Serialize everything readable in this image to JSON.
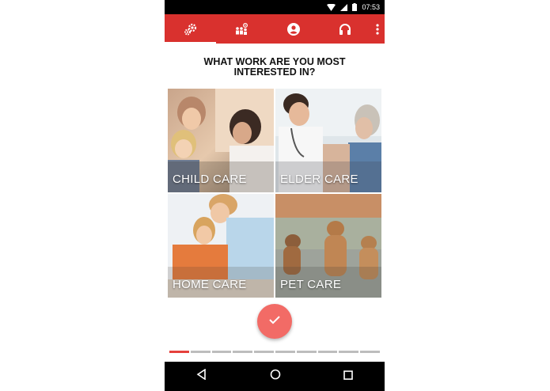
{
  "status_bar": {
    "time": "07:53",
    "icons": [
      "wifi-icon",
      "signal-icon",
      "battery-icon"
    ]
  },
  "toolbar": {
    "tabs": [
      {
        "name": "tab-settings",
        "icon": "gears-icon",
        "active": true
      },
      {
        "name": "tab-groups",
        "icon": "people-icon",
        "active": false
      },
      {
        "name": "tab-profile",
        "icon": "account-icon",
        "active": false
      },
      {
        "name": "tab-support",
        "icon": "headset-icon",
        "active": false
      }
    ],
    "overflow_icon": "more-vert-icon",
    "color": "#d9312e"
  },
  "question": {
    "line1": "WHAT WORK ARE YOU MOST",
    "line2": "INTERESTED IN?"
  },
  "care_options": [
    {
      "label": "CHILD CARE"
    },
    {
      "label": "ELDER CARE"
    },
    {
      "label": "HOME CARE"
    },
    {
      "label": "PET CARE"
    }
  ],
  "confirm": {
    "icon": "check-icon",
    "color": "#f26b66"
  },
  "progress": {
    "total_steps": 10,
    "current_step": 1,
    "accent": "#e5403c"
  },
  "nav_bar": {
    "icons": [
      "back-icon",
      "home-icon",
      "recents-icon"
    ]
  }
}
